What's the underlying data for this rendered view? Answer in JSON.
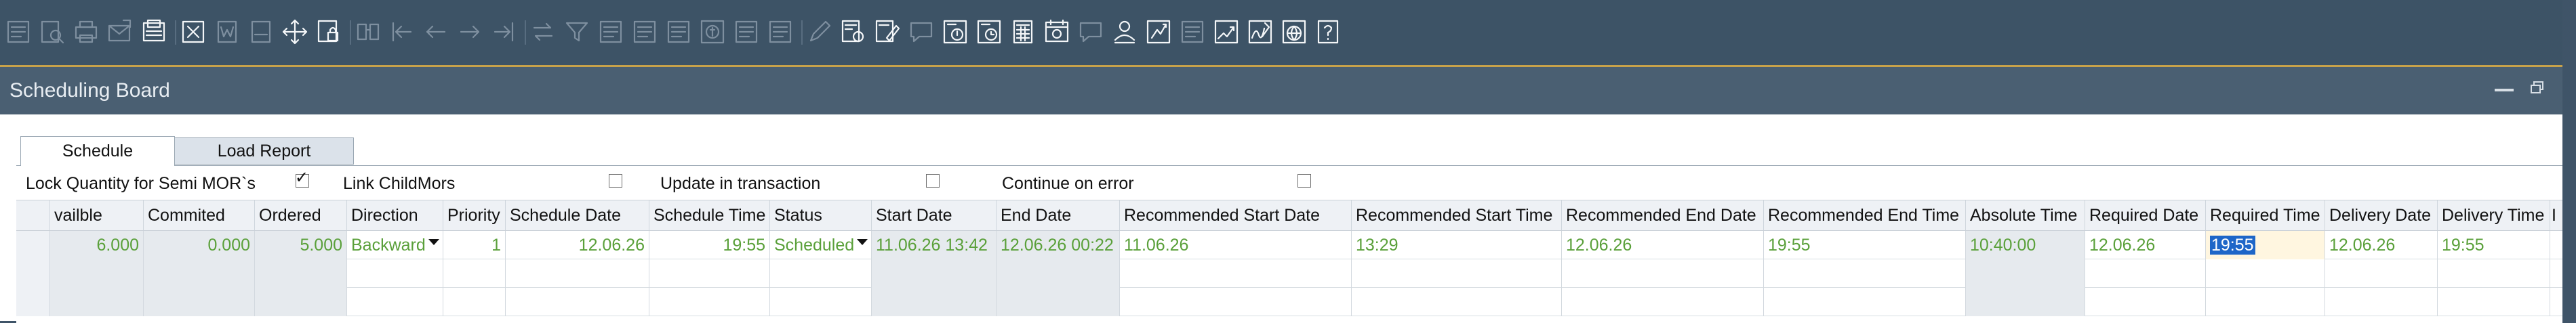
{
  "toolbar": {
    "buttons": [
      "form-settings-icon",
      "print-preview-icon",
      "print-icon",
      "send-icon",
      "fax-icon",
      "excel-icon",
      "word-icon",
      "pdf-icon",
      "move-icon",
      "lock-form-icon",
      "find-icon",
      "first-record-icon",
      "previous-record-icon",
      "next-record-icon",
      "last-record-icon",
      "refresh-icon",
      "filter-icon",
      "sort-icon",
      "base-document-icon",
      "target-document-icon",
      "payment-means-icon",
      "gross-profit-icon",
      "volume-weight-icon",
      "edit-icon",
      "settings-icon",
      "form-edit-icon",
      "message-icon",
      "alert-icon",
      "journal-icon",
      "calculator-icon",
      "calendar-icon",
      "chat-icon",
      "user-icon",
      "crystal-report-icon",
      "layout-icon",
      "chart-icon",
      "signature-icon",
      "web-icon",
      "help-icon"
    ]
  },
  "window": {
    "title": "Scheduling Board"
  },
  "tabs": [
    {
      "label": "Schedule",
      "active": true
    },
    {
      "label": "Load Report",
      "active": false
    }
  ],
  "options": {
    "lock_quantity": {
      "label": "Lock Quantity for Semi MOR`s",
      "checked": true
    },
    "link_childmors": {
      "label": "Link ChildMors",
      "checked": false
    },
    "update_in_transaction": {
      "label": "Update in transaction",
      "checked": false
    },
    "continue_on_error": {
      "label": "Continue on error",
      "checked": false
    }
  },
  "grid": {
    "columns": [
      "vailble",
      "Commited",
      "Ordered",
      "Direction",
      "Priority",
      "Schedule Date",
      "Schedule Time",
      "Status",
      "Start Date",
      "End Date",
      "Recommended Start Date",
      "Recommended Start Time",
      "Recommended End Date",
      "Recommended End Time",
      "Absolute Time",
      "Required Date",
      "Required Time",
      "Delivery Date",
      "Delivery Time",
      "I"
    ],
    "rows": [
      {
        "available": "6.000",
        "committed": "0.000",
        "ordered": "5.000",
        "direction": "Backward",
        "priority": "1",
        "schedule_date": "12.06.26",
        "schedule_time": "19:55",
        "status": "Scheduled",
        "start_date": "11.06.26 13:42",
        "end_date": "12.06.26 00:22",
        "rec_start_date": "11.06.26",
        "rec_start_time": "13:29",
        "rec_end_date": "12.06.26",
        "rec_end_time": "19:55",
        "absolute_time": "10:40:00",
        "required_date": "12.06.26",
        "required_time": "19:55",
        "delivery_date": "12.06.26",
        "delivery_time": "19:55"
      }
    ]
  },
  "colors": {
    "toolbar_bg": "#3d5366",
    "titlebar_bg": "#4a5f72",
    "accent": "#c8a24a",
    "value_green": "#5aa03a",
    "selection_blue": "#1e66c8"
  }
}
